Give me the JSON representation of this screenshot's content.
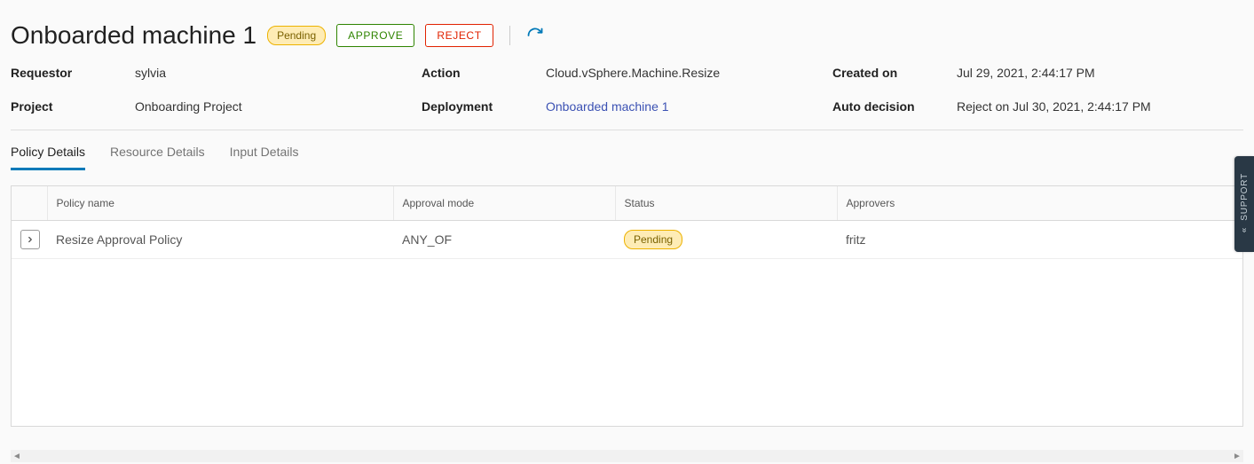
{
  "header": {
    "title": "Onboarded machine 1",
    "status_badge": "Pending",
    "approve_label": "APPROVE",
    "reject_label": "REJECT"
  },
  "meta": {
    "requestor_label": "Requestor",
    "requestor_value": "sylvia",
    "action_label": "Action",
    "action_value": "Cloud.vSphere.Machine.Resize",
    "created_label": "Created on",
    "created_value": "Jul 29, 2021, 2:44:17 PM",
    "project_label": "Project",
    "project_value": "Onboarding Project",
    "deployment_label": "Deployment",
    "deployment_value": "Onboarded machine 1",
    "autodecision_label": "Auto decision",
    "autodecision_value": "Reject on Jul 30, 2021, 2:44:17 PM"
  },
  "tabs": {
    "policy": "Policy Details",
    "resource": "Resource Details",
    "input": "Input Details"
  },
  "grid": {
    "columns": {
      "policy_name": "Policy name",
      "approval_mode": "Approval mode",
      "status": "Status",
      "approvers": "Approvers"
    },
    "rows": [
      {
        "policy_name": "Resize Approval Policy",
        "approval_mode": "ANY_OF",
        "status": "Pending",
        "approvers": "fritz"
      }
    ]
  },
  "support": {
    "label": "SUPPORT"
  }
}
